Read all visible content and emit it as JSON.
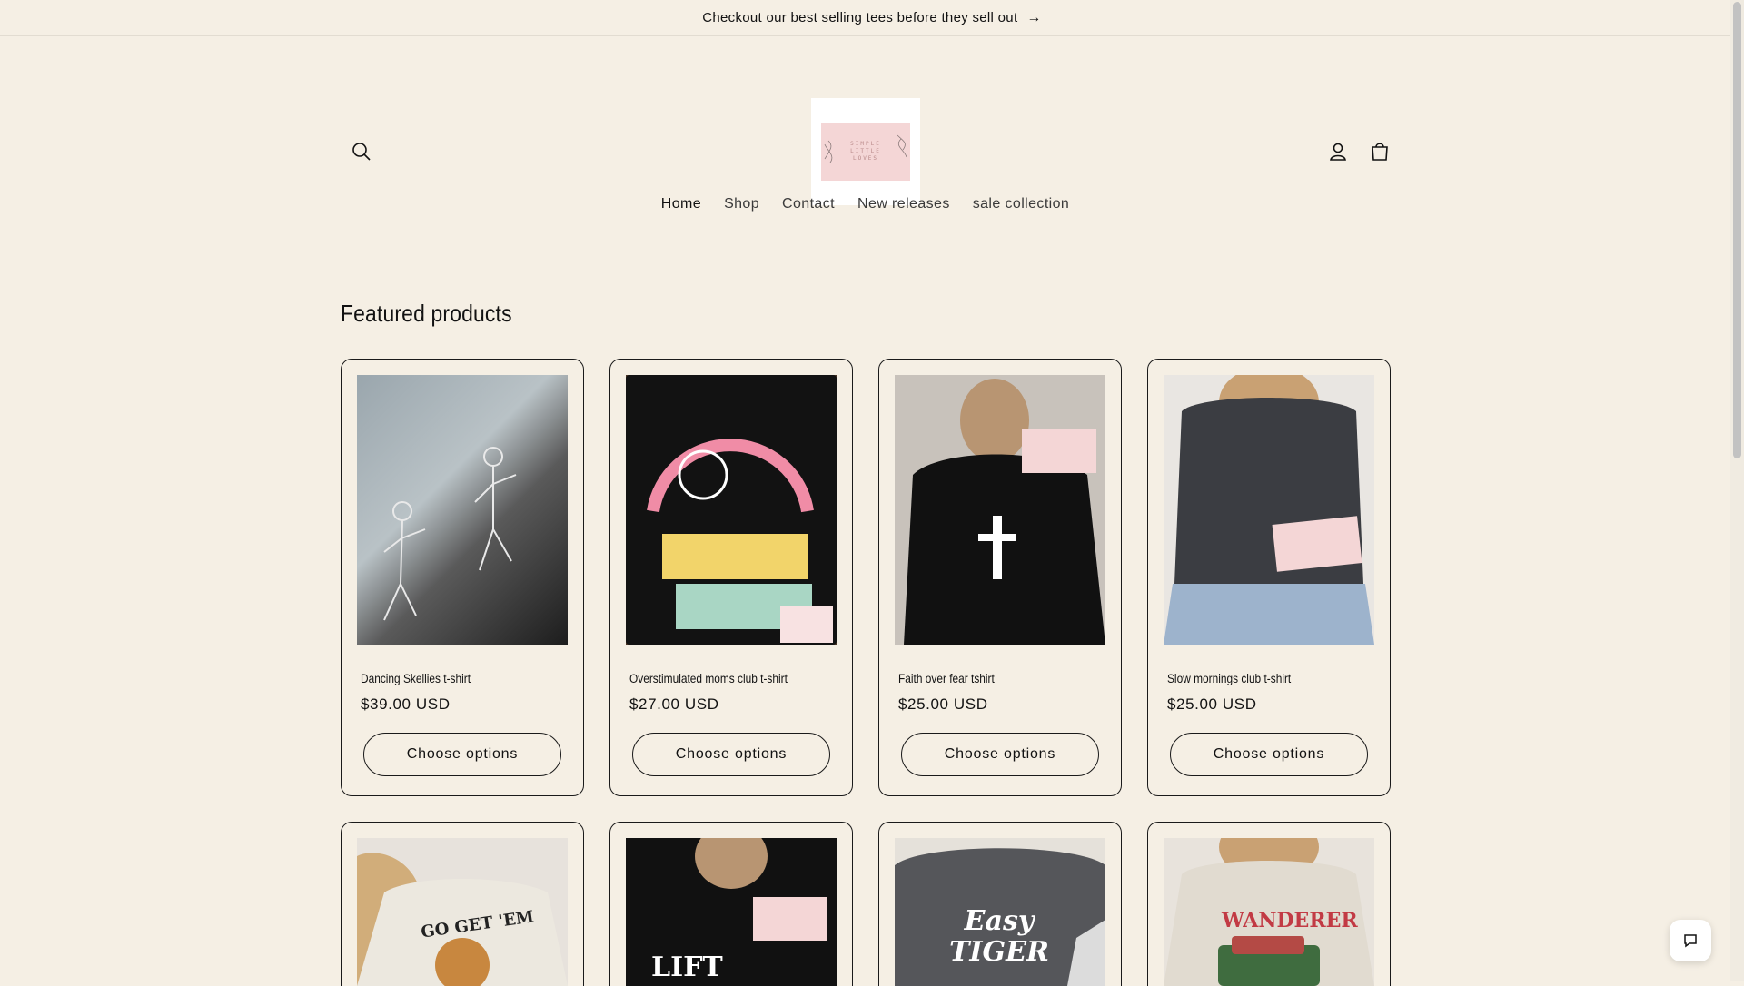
{
  "announcement": {
    "text": "Checkout our best selling tees before they sell out",
    "arrow": "→"
  },
  "header": {
    "logo_text": "SIMPLE LITTLE LOVES",
    "nav": [
      {
        "label": "Home",
        "active": true
      },
      {
        "label": "Shop"
      },
      {
        "label": "Contact"
      },
      {
        "label": "New releases"
      },
      {
        "label": "sale collection"
      }
    ],
    "icons": [
      "search-icon",
      "account-icon",
      "cart-icon"
    ]
  },
  "featured": {
    "title": "Featured products",
    "products": [
      {
        "name": "Dancing Skellies t-shirt",
        "price": "$39.00 USD",
        "button": "Choose options"
      },
      {
        "name": "Overstimulated moms club t-shirt",
        "price": "$27.00 USD",
        "button": "Choose options"
      },
      {
        "name": "Faith over fear tshirt",
        "price": "$25.00 USD",
        "button": "Choose options"
      },
      {
        "name": "Slow mornings club t-shirt",
        "price": "$25.00 USD",
        "button": "Choose options"
      }
    ],
    "partial_product_prints": [
      "GO GET 'EM",
      "LIFT",
      "Easy TIGER",
      "WANDERER"
    ]
  },
  "colors": {
    "background": "#f5efe4",
    "text": "#121212",
    "logo_bg": "#f4d6d6"
  }
}
